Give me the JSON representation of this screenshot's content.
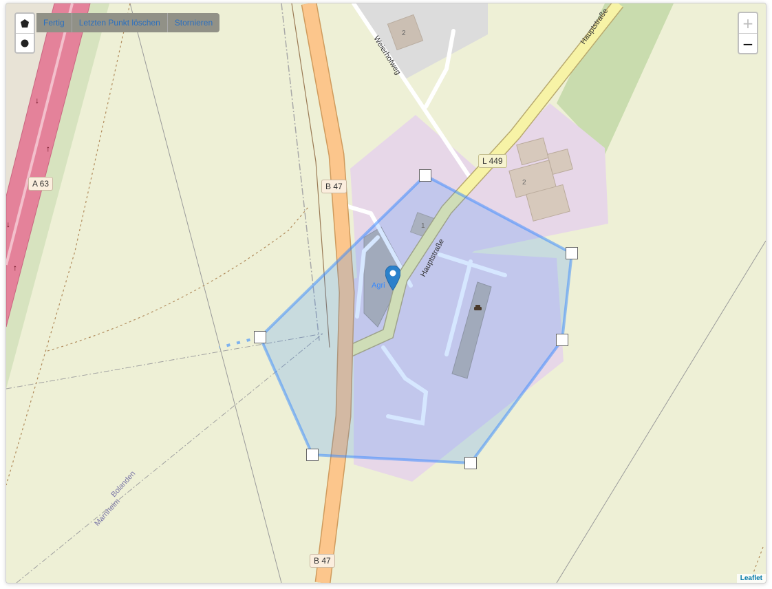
{
  "draw_toolbar": {
    "polygon_tool": "polygon-icon",
    "circle_tool": "circle-icon",
    "actions": [
      "Fertig",
      "Letzten Punkt löschen",
      "Stornieren"
    ]
  },
  "zoom": {
    "in_label": "+",
    "out_label": "−",
    "in_disabled": true
  },
  "map": {
    "labels": {
      "a63": "A 63",
      "b47_top": "B 47",
      "b47_bottom": "B 47",
      "l449": "L 449",
      "hauptstrasse_top": "Hauptstraße",
      "hauptstrasse_mid": "Hauptstraße",
      "weierhofweg": "Weierhofweg",
      "house_top": "2",
      "house_right": "2",
      "house_mid": "1",
      "bolanden": "Bolanden",
      "marnheim": "Marnheim",
      "marker_label": "Agri"
    },
    "polygon_color": "#3388ff",
    "landuse_color": "#e7d7e8",
    "motorway_color": "#e4829a",
    "primary_color": "#fcc68c",
    "secondary_color": "#f7f3a6"
  },
  "attribution": "Leaflet"
}
